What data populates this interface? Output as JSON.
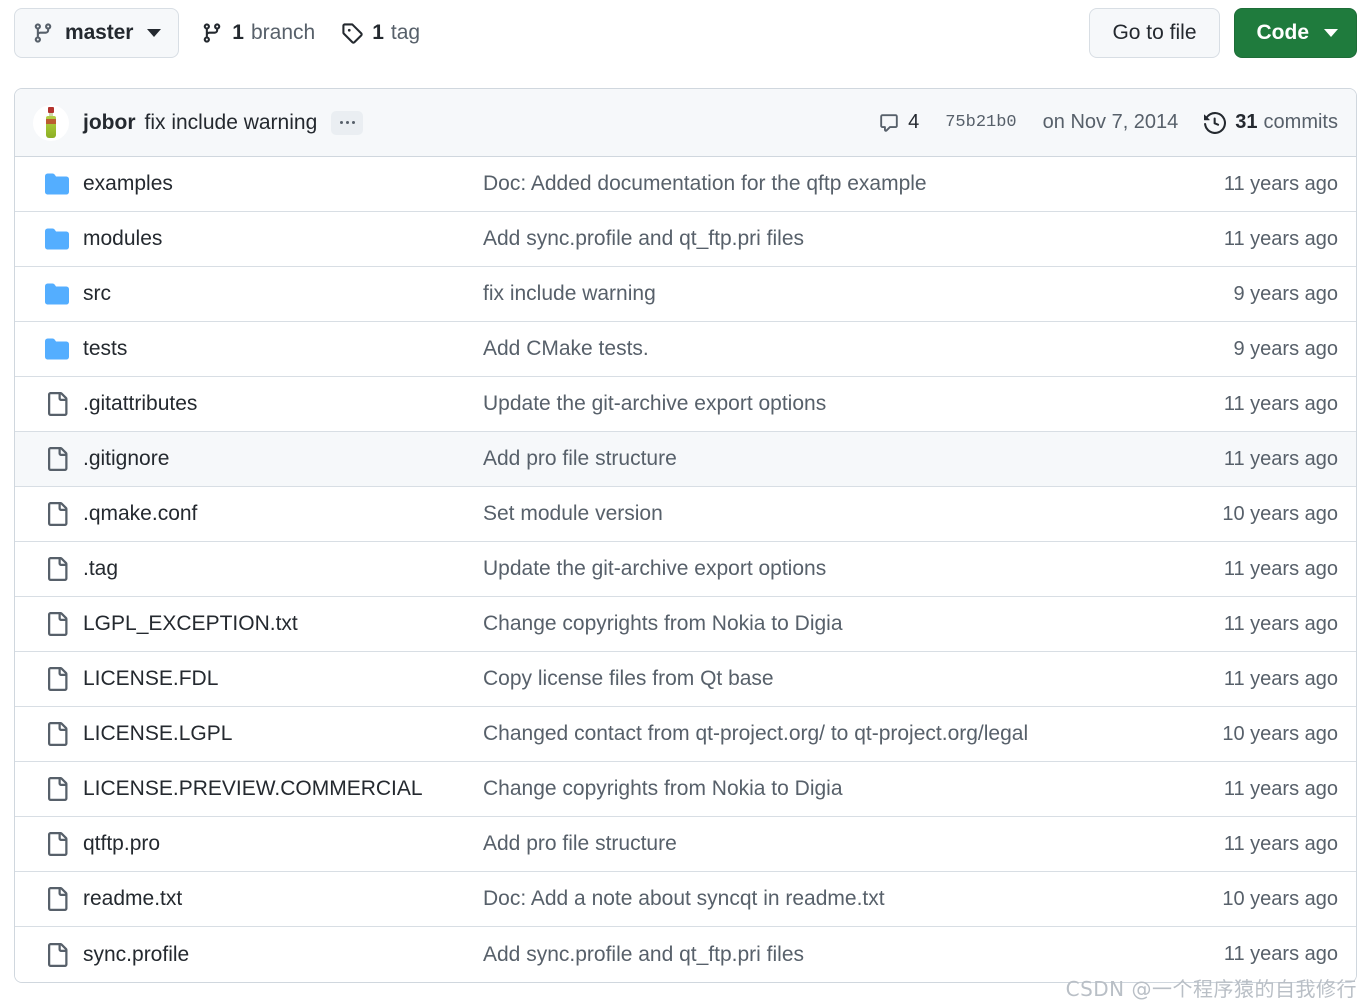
{
  "toolbar": {
    "branch_icon": "git-branch-icon",
    "branch_name": "master",
    "branch_count_num": "1",
    "branch_count_word": "branch",
    "branch_count_icon": "git-branch-icon",
    "tag_count_num": "1",
    "tag_count_word": "tag",
    "tag_count_icon": "tag-icon",
    "go_to_file_label": "Go to file",
    "code_label": "Code",
    "code_caret_icon": "chevron-down-icon"
  },
  "commit_header": {
    "avatar_icon": "user-avatar",
    "author": "jobor",
    "message": "fix include warning",
    "ellipsis_label": "…",
    "comments_icon": "comment-icon",
    "comments_count": "4",
    "sha": "75b21b0",
    "date": "on Nov 7, 2014",
    "history_icon": "history-icon",
    "commits_count": "31",
    "commits_word": "commits"
  },
  "colors": {
    "folder": "#54aeff",
    "file_outline": "#57606a",
    "code_button": "#1f7b3d",
    "border": "#d0d7de",
    "row_highlight": "#f6f8fa",
    "header_bg": "#f6f8fa"
  },
  "files": [
    {
      "type": "folder",
      "icon": "folder-icon",
      "name": "examples",
      "message": "Doc: Added documentation for the qftp example",
      "time": "11 years ago",
      "highlight": false
    },
    {
      "type": "folder",
      "icon": "folder-icon",
      "name": "modules",
      "message": "Add sync.profile and qt_ftp.pri files",
      "time": "11 years ago",
      "highlight": false
    },
    {
      "type": "folder",
      "icon": "folder-icon",
      "name": "src",
      "message": "fix include warning",
      "time": "9 years ago",
      "highlight": false
    },
    {
      "type": "folder",
      "icon": "folder-icon",
      "name": "tests",
      "message": "Add CMake tests.",
      "time": "9 years ago",
      "highlight": false
    },
    {
      "type": "file",
      "icon": "file-icon",
      "name": ".gitattributes",
      "message": "Update the git-archive export options",
      "time": "11 years ago",
      "highlight": false
    },
    {
      "type": "file",
      "icon": "file-icon",
      "name": ".gitignore",
      "message": "Add pro file structure",
      "time": "11 years ago",
      "highlight": true
    },
    {
      "type": "file",
      "icon": "file-icon",
      "name": ".qmake.conf",
      "message": "Set module version",
      "time": "10 years ago",
      "highlight": false
    },
    {
      "type": "file",
      "icon": "file-icon",
      "name": ".tag",
      "message": "Update the git-archive export options",
      "time": "11 years ago",
      "highlight": false
    },
    {
      "type": "file",
      "icon": "file-icon",
      "name": "LGPL_EXCEPTION.txt",
      "message": "Change copyrights from Nokia to Digia",
      "time": "11 years ago",
      "highlight": false
    },
    {
      "type": "file",
      "icon": "file-icon",
      "name": "LICENSE.FDL",
      "message": "Copy license files from Qt base",
      "time": "11 years ago",
      "highlight": false
    },
    {
      "type": "file",
      "icon": "file-icon",
      "name": "LICENSE.LGPL",
      "message": "Changed contact from qt-project.org/ to qt-project.org/legal",
      "time": "10 years ago",
      "highlight": false
    },
    {
      "type": "file",
      "icon": "file-icon",
      "name": "LICENSE.PREVIEW.COMMERCIAL",
      "message": "Change copyrights from Nokia to Digia",
      "time": "11 years ago",
      "highlight": false
    },
    {
      "type": "file",
      "icon": "file-icon",
      "name": "qtftp.pro",
      "message": "Add pro file structure",
      "time": "11 years ago",
      "highlight": false
    },
    {
      "type": "file",
      "icon": "file-icon",
      "name": "readme.txt",
      "message": "Doc: Add a note about syncqt in readme.txt",
      "time": "10 years ago",
      "highlight": false
    },
    {
      "type": "file",
      "icon": "file-icon",
      "name": "sync.profile",
      "message": "Add sync.profile and qt_ftp.pri files",
      "time": "11 years ago",
      "highlight": false
    }
  ],
  "watermark": "CSDN @一个程序猿的自我修行"
}
